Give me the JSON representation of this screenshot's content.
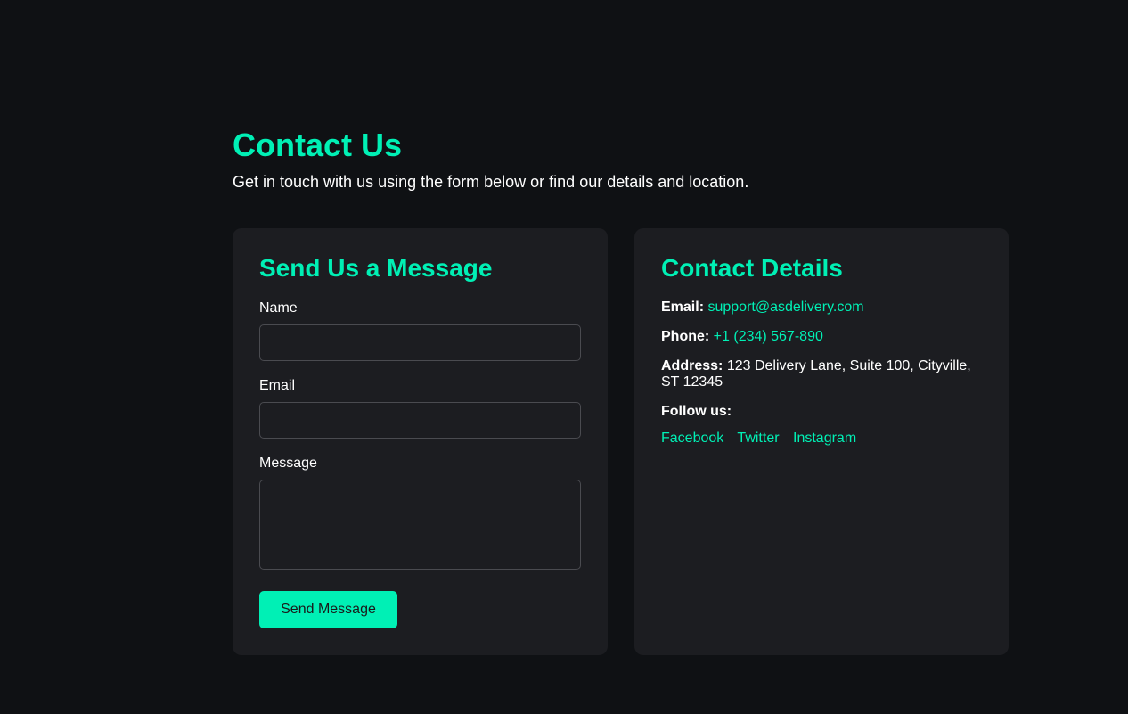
{
  "header": {
    "title": "Contact Us",
    "subtitle": "Get in touch with us using the form below or find our details and location."
  },
  "form": {
    "title": "Send Us a Message",
    "name_label": "Name",
    "name_value": "",
    "email_label": "Email",
    "email_value": "",
    "message_label": "Message",
    "message_value": "",
    "submit_label": "Send Message"
  },
  "details": {
    "title": "Contact Details",
    "email_label": "Email:",
    "email_value": "support@asdelivery.com",
    "phone_label": "Phone:",
    "phone_value": "+1 (234) 567-890",
    "address_label": "Address:",
    "address_value": "123 Delivery Lane, Suite 100, Cityville, ST 12345",
    "follow_label": "Follow us:",
    "social": [
      "Facebook",
      "Twitter",
      "Instagram"
    ]
  },
  "colors": {
    "background": "#0f1114",
    "card": "#1c1d21",
    "accent": "#00f0b5",
    "text": "#ffffff",
    "input_border": "#4a4b50"
  }
}
